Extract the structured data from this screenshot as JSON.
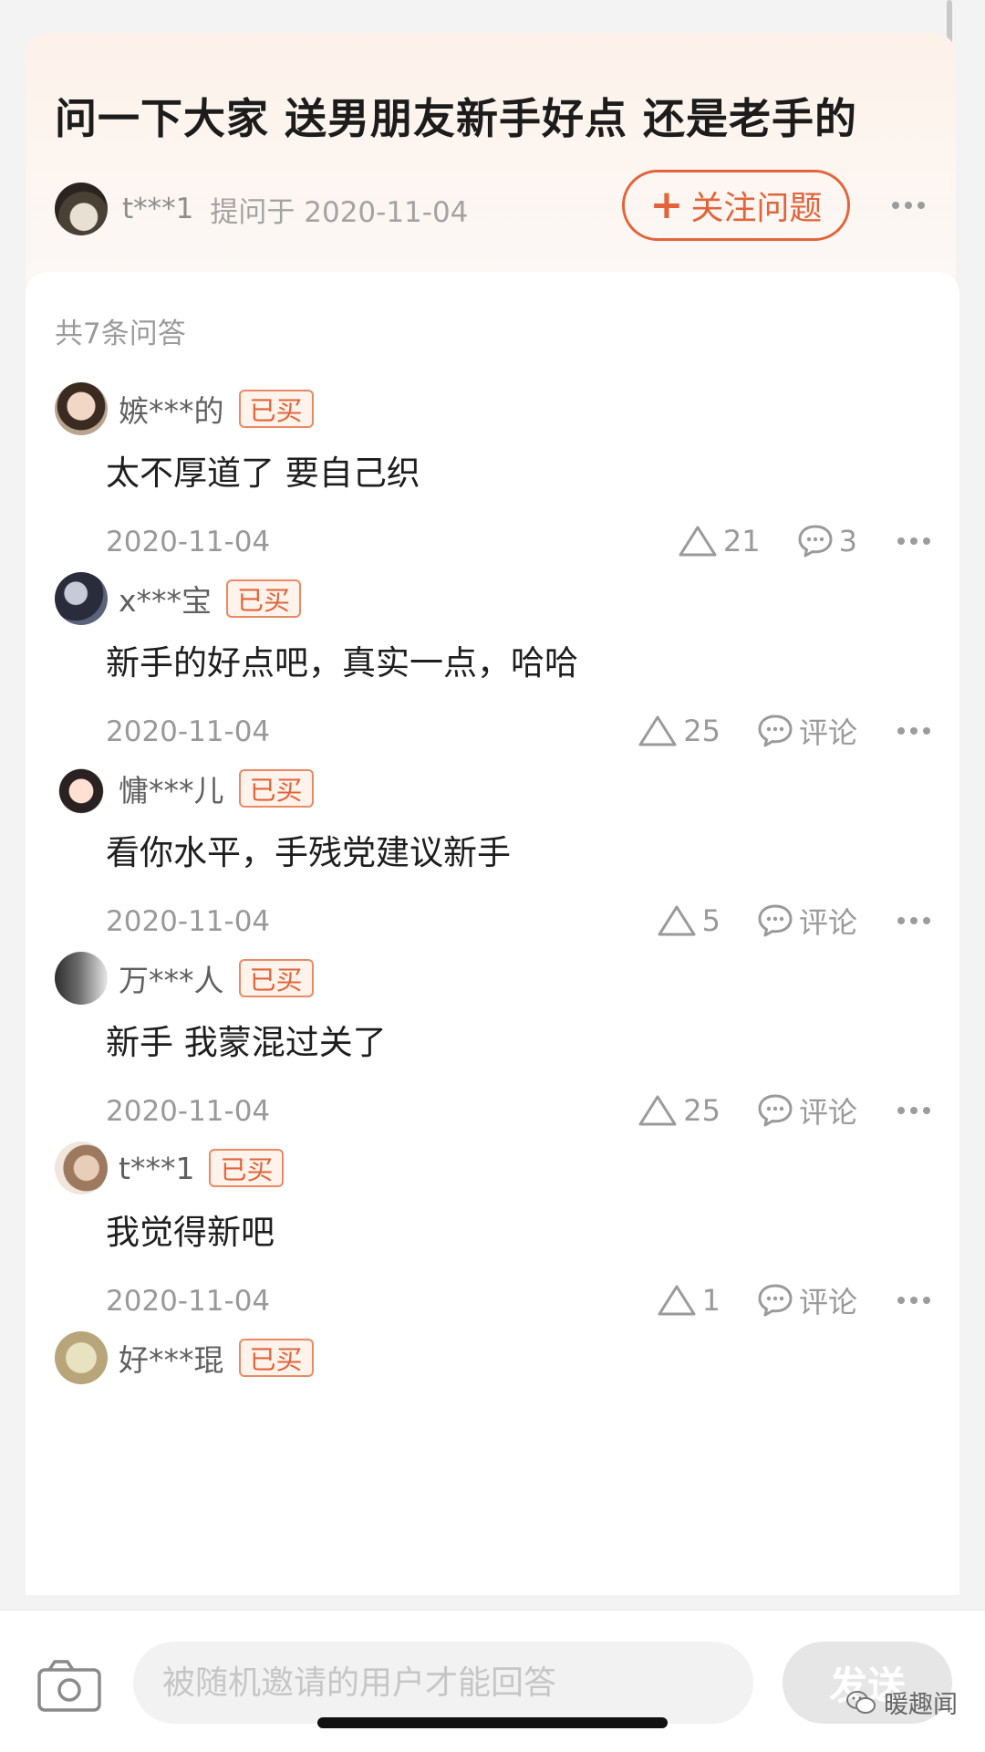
{
  "question": {
    "title": "问一下大家 送男朋友新手好点 还是老手的",
    "asker_name": "t***1",
    "asked_at": "提问于 2020-11-04",
    "follow_label": "关注问题",
    "follow_plus": "+"
  },
  "answers_header": {
    "count_label": "共7条问答"
  },
  "bought_label": "已买",
  "answers": [
    {
      "user": "嫉***的",
      "text": "太不厚道了 要自己织",
      "date": "2020-11-04",
      "likes": "21",
      "comment": "3"
    },
    {
      "user": "x***宝",
      "text": "新手的好点吧，真实一点，哈哈",
      "date": "2020-11-04",
      "likes": "25",
      "comment": "评论"
    },
    {
      "user": "慵***儿",
      "text": "看你水平，手残党建议新手",
      "date": "2020-11-04",
      "likes": "5",
      "comment": "评论"
    },
    {
      "user": "万***人",
      "text": "新手 我蒙混过关了",
      "date": "2020-11-04",
      "likes": "25",
      "comment": "评论"
    },
    {
      "user": "t***1",
      "text": "我觉得新吧",
      "date": "2020-11-04",
      "likes": "1",
      "comment": "评论"
    },
    {
      "user": "好***琨",
      "text": "",
      "date": "",
      "likes": "",
      "comment": ""
    }
  ],
  "reply_bar": {
    "placeholder": "被随机邀请的用户才能回答",
    "send_label": "发送"
  },
  "watermark": {
    "text": "暖趣闻"
  },
  "icons": {
    "camera": "camera-icon",
    "like": "triangle-like-icon",
    "comment": "comment-bubble-icon",
    "more": "more-dots-icon"
  },
  "colors": {
    "accent": "#e2643a",
    "card_header_bg": "#fdf1ea"
  }
}
